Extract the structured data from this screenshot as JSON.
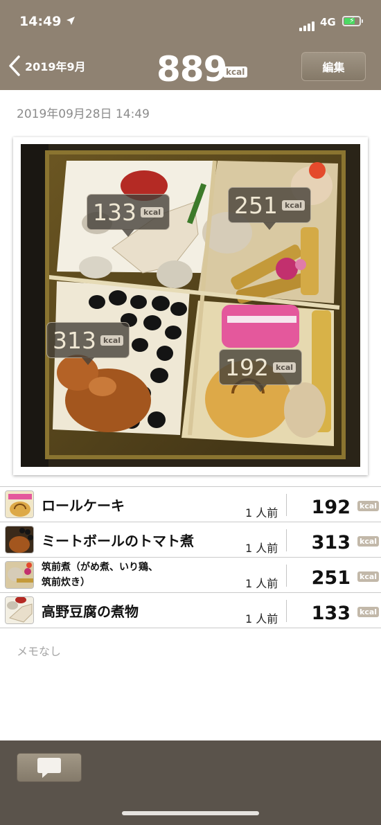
{
  "status_bar": {
    "time": "14:49",
    "network": "4G",
    "icons": [
      "location-arrow-icon",
      "signal-icon",
      "battery-charging-icon"
    ]
  },
  "nav": {
    "back_label": "2019年9月",
    "total_kcal": "889",
    "kcal_unit": "kcal",
    "edit_label": "編集"
  },
  "meal": {
    "datetime": "2019年09月28日 14:49"
  },
  "photo_labels": [
    {
      "value": "133",
      "unit": "kcal"
    },
    {
      "value": "251",
      "unit": "kcal"
    },
    {
      "value": "313",
      "unit": "kcal"
    },
    {
      "value": "192",
      "unit": "kcal"
    }
  ],
  "foods": [
    {
      "name": "ロールケーキ",
      "portion": "1 人前",
      "kcal": "192",
      "unit": "kcal"
    },
    {
      "name": "ミートボールのトマト煮",
      "portion": "1 人前",
      "kcal": "313",
      "unit": "kcal"
    },
    {
      "name": "筑前煮（がめ煮、いり鶏、\n筑前炊き）",
      "portion": "1 人前",
      "kcal": "251",
      "unit": "kcal"
    },
    {
      "name": "高野豆腐の煮物",
      "portion": "1 人前",
      "kcal": "133",
      "unit": "kcal"
    }
  ],
  "memo": "メモなし",
  "toolbar": {
    "comment_icon": "speech-bubble-icon"
  },
  "colors": {
    "header": "#8f8272",
    "toolbar": "#5a534b",
    "kcal_badge": "#c2b8a9"
  }
}
